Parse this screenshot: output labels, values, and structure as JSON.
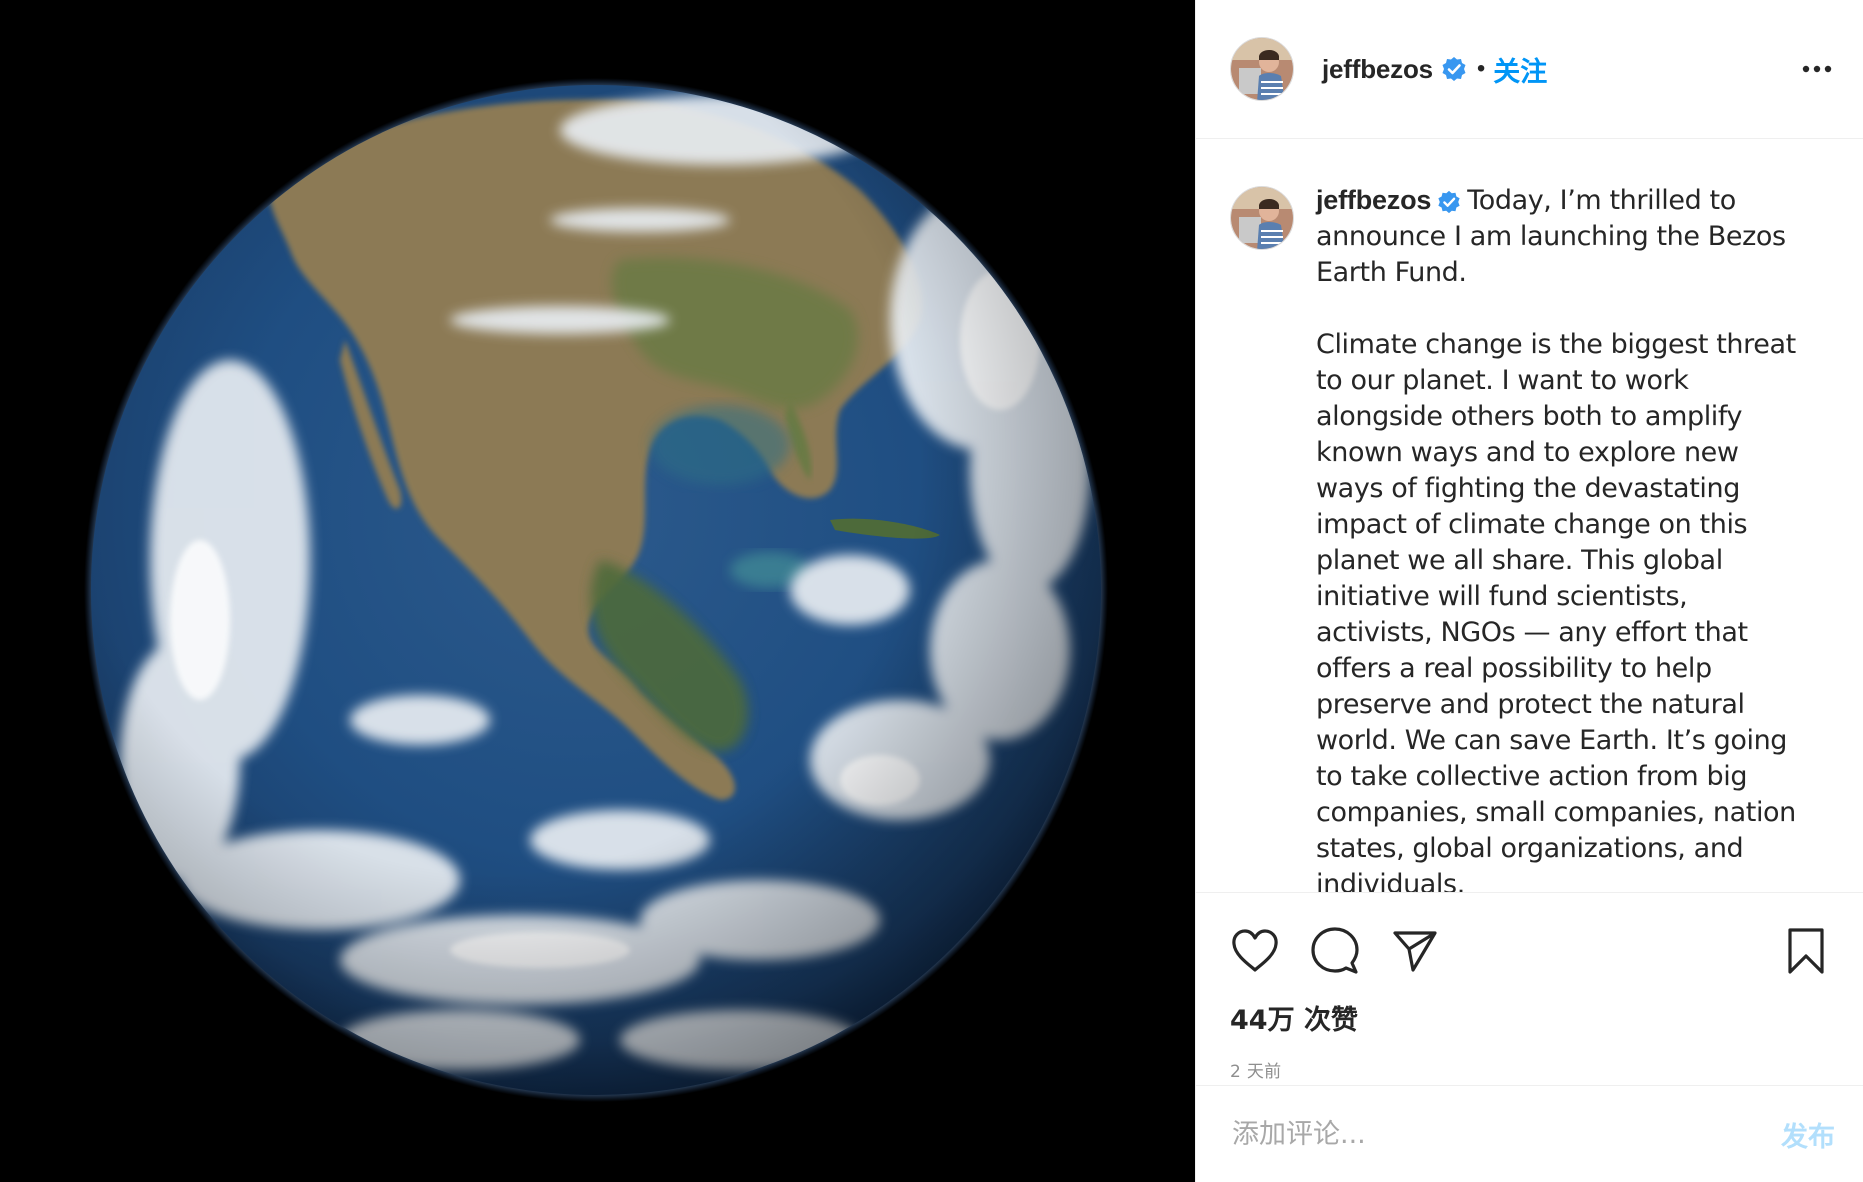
{
  "colors": {
    "link_blue": "#0095f6",
    "post_disabled_blue": "#b2dffc",
    "text": "#262626",
    "muted": "#8e8e8e",
    "divider": "#efefef",
    "media_background": "#000000"
  },
  "header": {
    "username": "jeffbezos",
    "verified_icon": "verified-badge-icon",
    "separator": "•",
    "follow_label": "关注",
    "more_icon": "more-options-icon"
  },
  "caption": {
    "username": "jeffbezos",
    "paragraph1": "Today, I’m thrilled to announce I am launching the Bezos Earth Fund.",
    "paragraph2": "Climate change is the biggest threat to our planet. I want to work alongside others both to amplify known ways and to explore new ways of fighting the devastating impact of climate change on this planet we all share. This global initiative will fund scientists, activists, NGOs — any effort that offers a real possibility to help preserve and protect the natural world. We can save Earth. It’s going to take collective action from big companies, small companies, nation states, global organizations, and individuals."
  },
  "actions": {
    "like_icon": "heart-icon",
    "comment_icon": "comment-bubble-icon",
    "share_icon": "paper-plane-icon",
    "save_icon": "bookmark-icon"
  },
  "likes_text": "44万 次赞",
  "timestamp": "2 天前",
  "comment_box": {
    "placeholder": "添加评论...",
    "value": "",
    "post_label": "发布"
  }
}
